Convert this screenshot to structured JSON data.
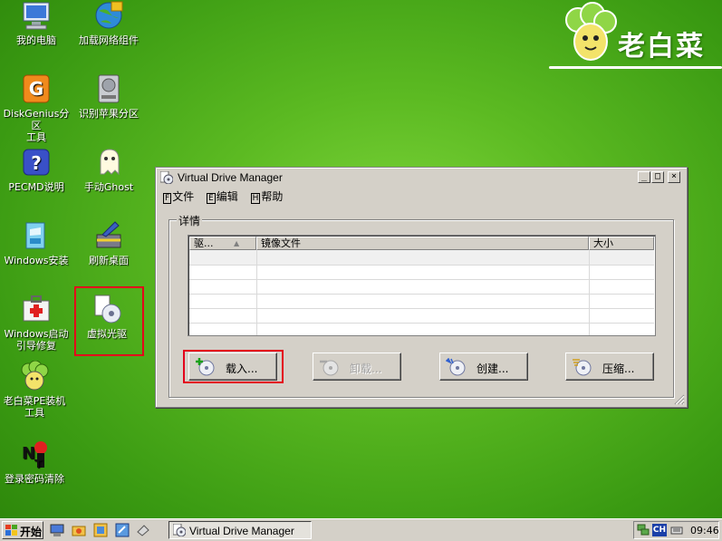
{
  "desktop": {
    "icons": [
      {
        "label": "我的电脑",
        "icon": "my-computer-icon"
      },
      {
        "label": "加载网络组件",
        "icon": "network-globe-icon"
      },
      {
        "label": "DiskGenius分区\n工具",
        "icon": "diskgenius-icon"
      },
      {
        "label": "识别苹果分区",
        "icon": "hard-disk-icon"
      },
      {
        "label": "PECMD说明",
        "icon": "help-icon"
      },
      {
        "label": "手动Ghost",
        "icon": "ghost-icon"
      },
      {
        "label": "Windows安装",
        "icon": "windows-install-icon"
      },
      {
        "label": "刷新桌面",
        "icon": "broom-icon"
      },
      {
        "label": "Windows启动\n引导修复",
        "icon": "first-aid-icon"
      },
      {
        "label": "虚拟光驱",
        "icon": "virtual-drive-icon"
      },
      {
        "label": "老白菜PE装机\n工具",
        "icon": "cabbage-mascot-icon"
      },
      {
        "label": "登录密码清除",
        "icon": "no-password-icon"
      }
    ]
  },
  "logo": {
    "text": "老白菜"
  },
  "window": {
    "title": "Virtual Drive Manager",
    "menu": [
      {
        "key": "F",
        "label": "文件"
      },
      {
        "key": "E",
        "label": "编辑"
      },
      {
        "key": "H",
        "label": "帮助"
      }
    ],
    "group_label": "详情",
    "columns": [
      "驱...",
      "镜像文件",
      "大小"
    ],
    "buttons": [
      {
        "label": "载入...",
        "enabled": true
      },
      {
        "label": "卸载...",
        "enabled": false
      },
      {
        "label": "创建...",
        "enabled": true
      },
      {
        "label": "压缩...",
        "enabled": true
      }
    ],
    "title_buttons": {
      "minimize": "_",
      "maximize": "□",
      "close": "×"
    }
  },
  "taskbar": {
    "start_label": "开始",
    "task_label": "Virtual Drive Manager",
    "lang": "CH",
    "clock": "09:46"
  },
  "colors": {
    "highlight": "#e3001b",
    "desktop": "#5cba22"
  }
}
